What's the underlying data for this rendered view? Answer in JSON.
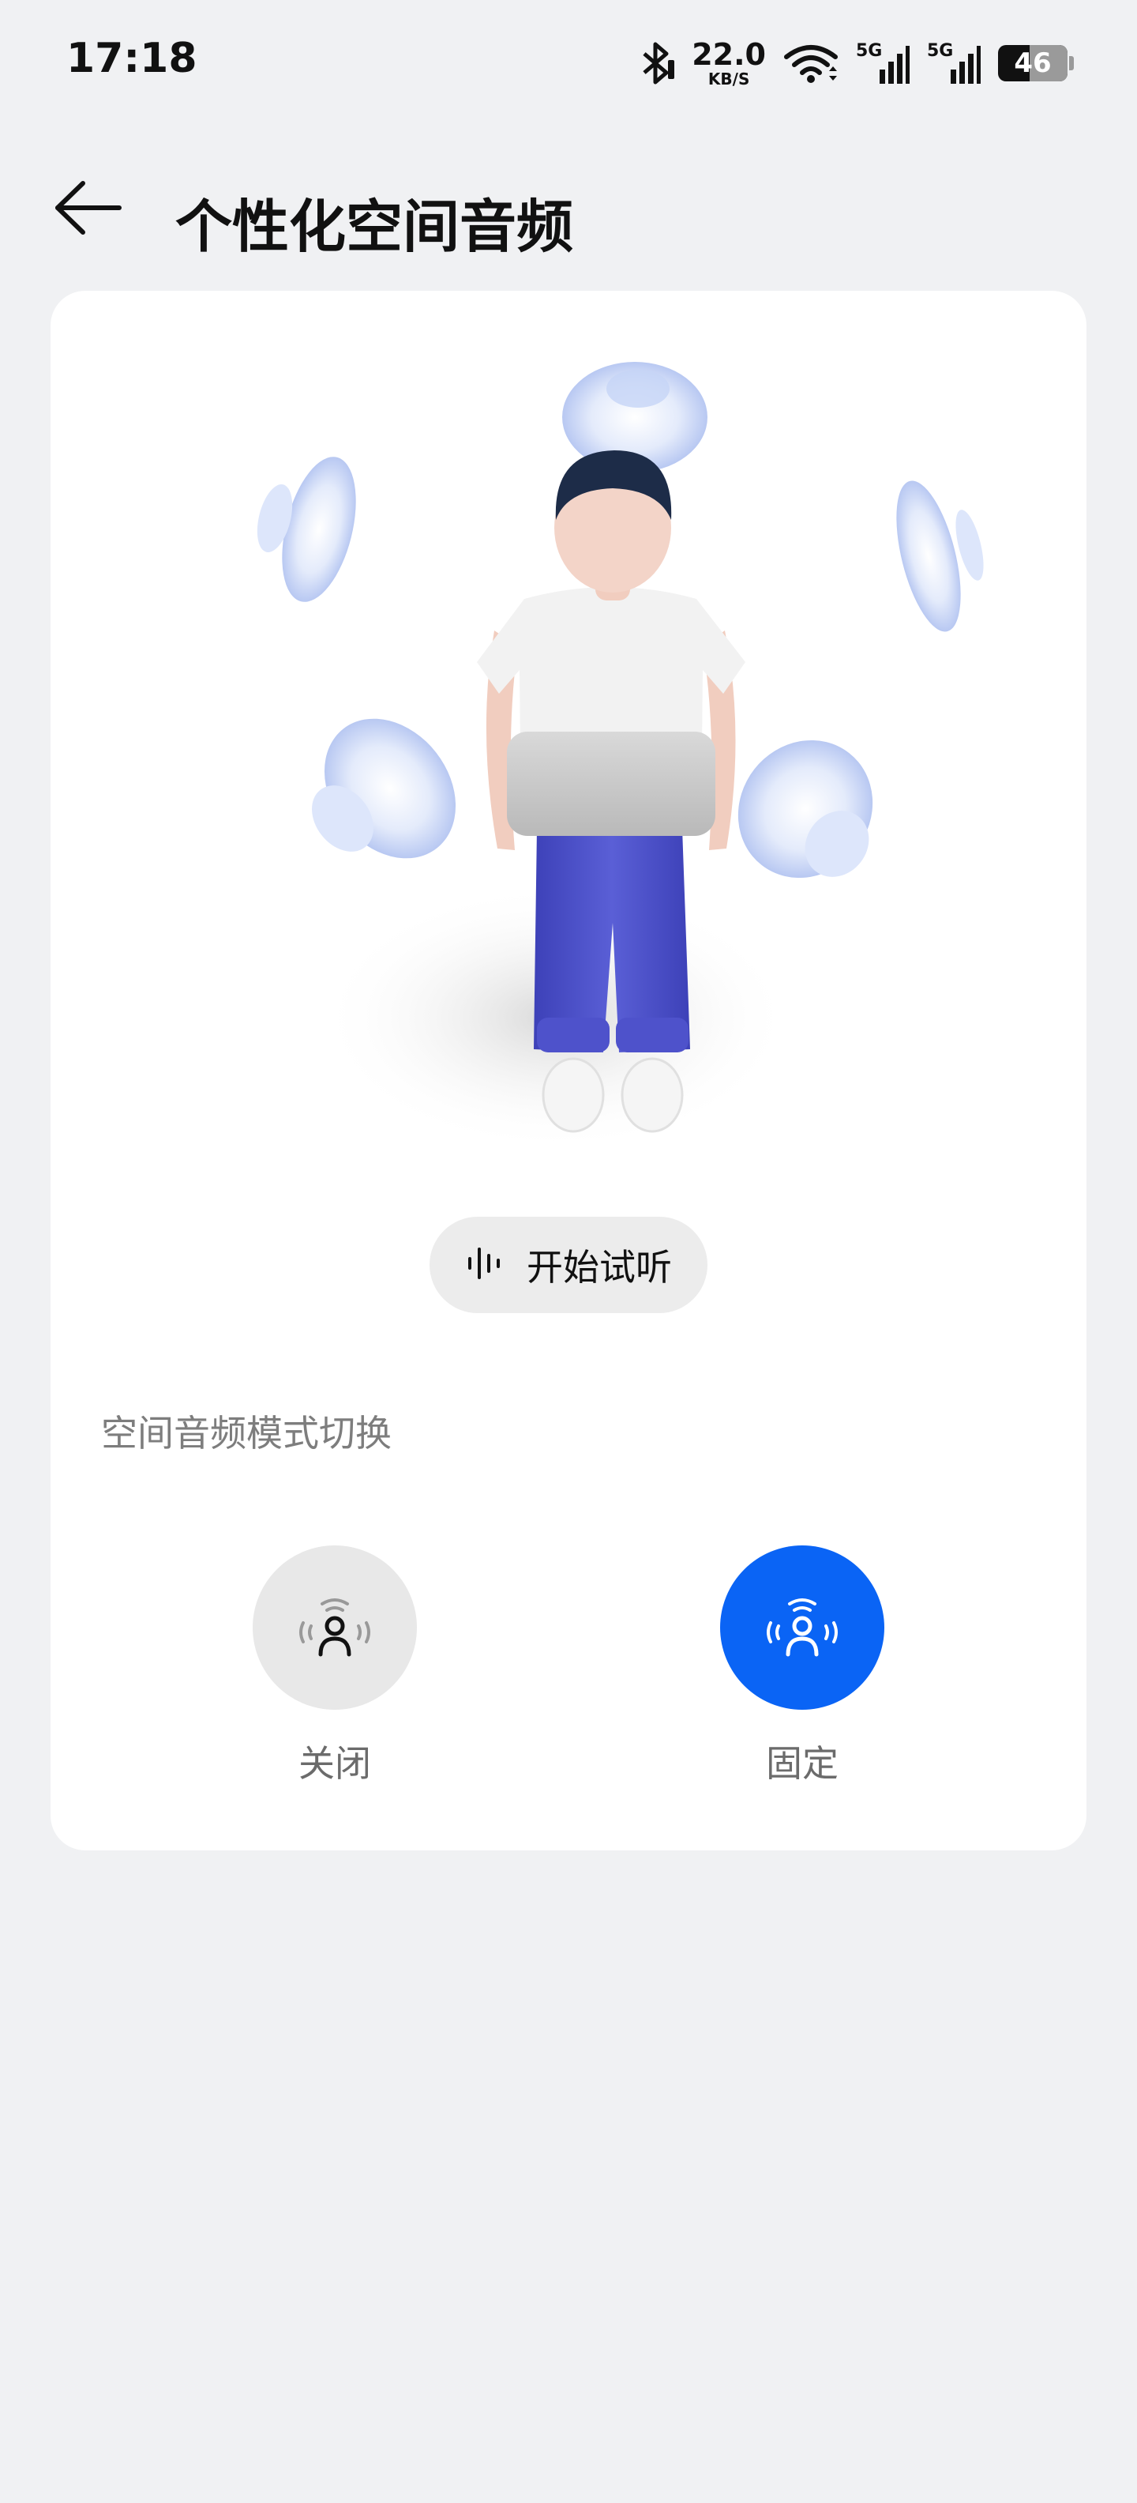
{
  "status_bar": {
    "time": "17:18",
    "net_speed_value": "22.0",
    "net_speed_unit": "KB/S",
    "sim1_tag": "5G",
    "sim2_tag": "5G",
    "battery_level": "46",
    "icons": [
      "bluetooth-icon",
      "wifi-icon",
      "signal-icon",
      "battery-icon"
    ]
  },
  "header": {
    "title": "个性化空间音频",
    "back_icon": "arrow-left-icon"
  },
  "card": {
    "listen_button_label": "开始试听",
    "listen_icon": "waveform-icon",
    "section_label": "空间音频模式切换",
    "modes": [
      {
        "label": "关闭",
        "icon": "person-sound-icon",
        "selected": false
      },
      {
        "label": "固定",
        "icon": "person-sound-icon",
        "selected": true
      }
    ]
  },
  "colors": {
    "page_background": "#f0f1f3",
    "card_background": "#ffffff",
    "accent": "#0a64f5",
    "unselected_circle": "#e8e8e8",
    "pants": "#4b4fc7",
    "sound_disc": "#c9d6f7"
  }
}
